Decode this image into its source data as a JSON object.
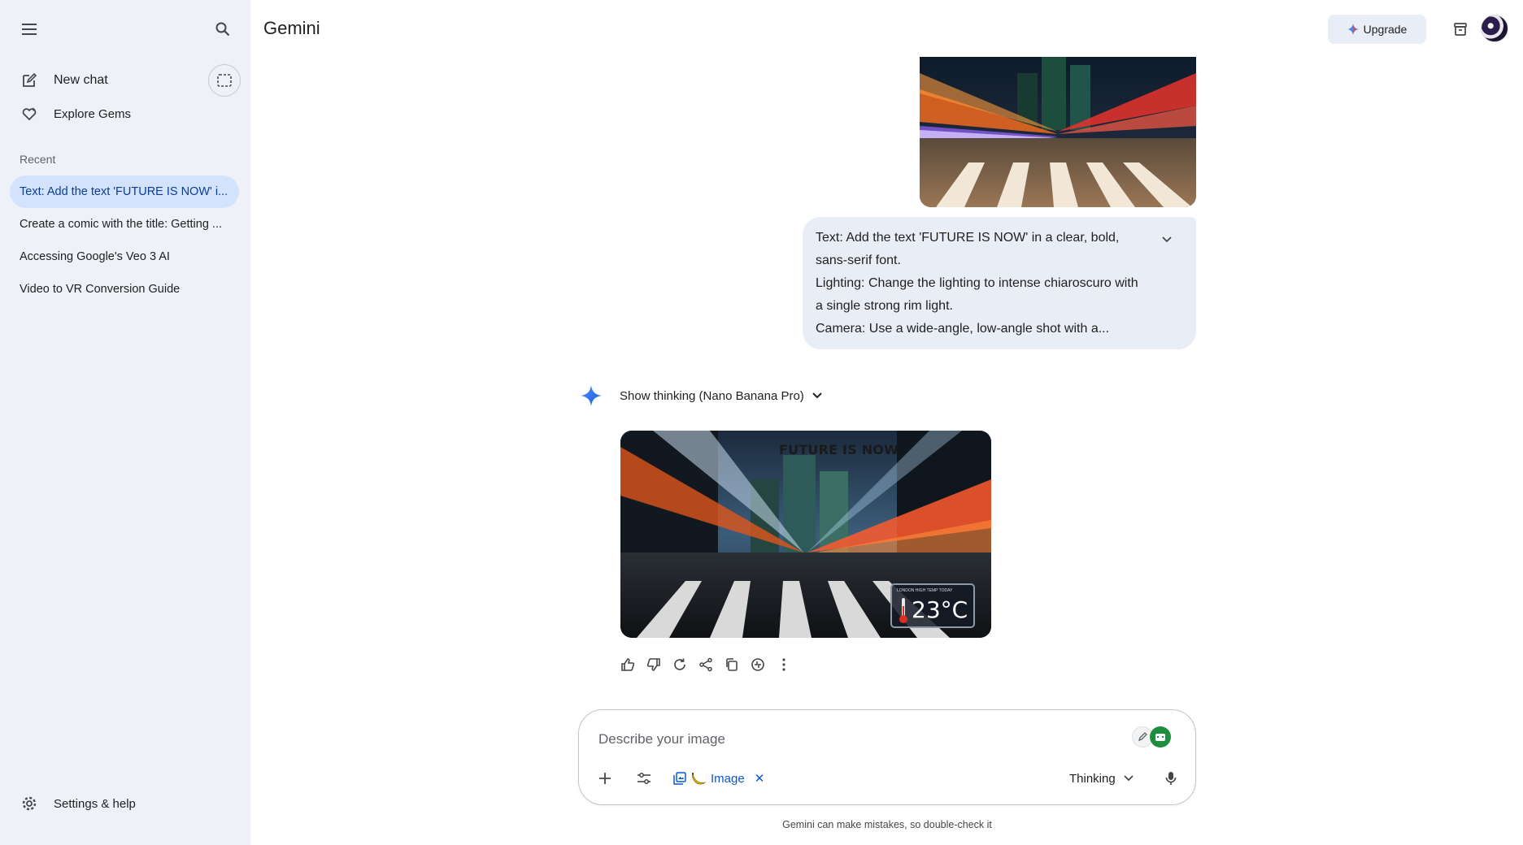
{
  "sidebar": {
    "menu_icon": "hamburger-menu-icon",
    "search_icon": "search-icon",
    "new_chat_label": "New chat",
    "explore_label": "Explore Gems",
    "recent_label": "Recent",
    "items": [
      {
        "label": "Text: Add the text 'FUTURE IS NOW' i...",
        "active": true
      },
      {
        "label": "Create a comic with the title: Getting ...",
        "active": false
      },
      {
        "label": "Accessing Google's Veo 3 AI",
        "active": false
      },
      {
        "label": "Video to VR Conversion Guide",
        "active": false
      }
    ],
    "settings_label": "Settings & help"
  },
  "header": {
    "title": "Gemini",
    "upgrade_label": "Upgrade"
  },
  "conversation": {
    "user_prompt_lines": [
      "Text: Add the text 'FUTURE IS NOW' in a clear, bold,",
      "sans-serif font.",
      "Lighting: Change the lighting to intense chiaroscuro with",
      "a single strong rim light.",
      "Camera: Use a wide-angle, low-angle shot with a..."
    ],
    "thinking_label": "Show thinking (Nano Banana Pro)",
    "generated_image_text": "FUTURE IS NOW",
    "weather_widget": {
      "city": "LONDON HIGH TEMP TODAY",
      "temp": "23°C"
    }
  },
  "composer": {
    "placeholder": "Describe your image",
    "image_chip_label": "Image",
    "image_chip_close": "✕",
    "model_label": "Thinking"
  },
  "disclaimer": "Gemini can make mistakes, so double-check it",
  "colors": {
    "sidebar_bg": "#eef1f8",
    "active_item_bg": "#d3e3fd",
    "accent_blue": "#0b57d0",
    "bubble_bg": "#e9eef6"
  }
}
